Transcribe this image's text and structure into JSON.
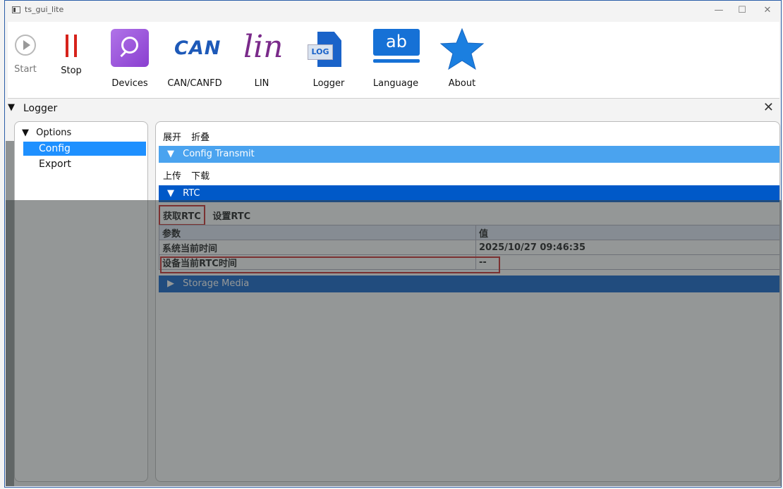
{
  "window": {
    "title": "ts_gui_lite"
  },
  "toolbar": {
    "start_label": "Start",
    "stop_label": "Stop",
    "devices_label": "Devices",
    "can_label": "CAN/CANFD",
    "can_icon_text": "CAN",
    "lin_label": "LIN",
    "lin_icon_text": "lin",
    "logger_label": "Logger",
    "logger_icon_text": "LOG",
    "language_label": "Language",
    "language_icon_text": "ab",
    "about_label": "About"
  },
  "panel": {
    "title": "Logger"
  },
  "sidebar": {
    "root_label": "Options",
    "items": [
      {
        "label": "Config",
        "selected": true
      },
      {
        "label": "Export",
        "selected": false
      }
    ]
  },
  "main": {
    "expand_label": "展开",
    "collapse_label": "折叠",
    "config_transmit": "Config Transmit",
    "upload_label": "上传",
    "download_label": "下载",
    "rtc_section": "RTC",
    "get_rtc_button": "获取RTC",
    "set_rtc_button": "设置RTC",
    "table": {
      "headers": [
        "参数",
        "值"
      ],
      "rows": [
        [
          "系统当前时间",
          "2025/10/27 09:46:35"
        ],
        [
          "设备当前RTC时间",
          "--"
        ]
      ]
    },
    "storage_section": "Storage Media"
  },
  "colors": {
    "section_light": "#4aa3ef",
    "section_dark": "#0059c8",
    "highlight": "#c81e1e",
    "selection": "#1e90ff"
  }
}
